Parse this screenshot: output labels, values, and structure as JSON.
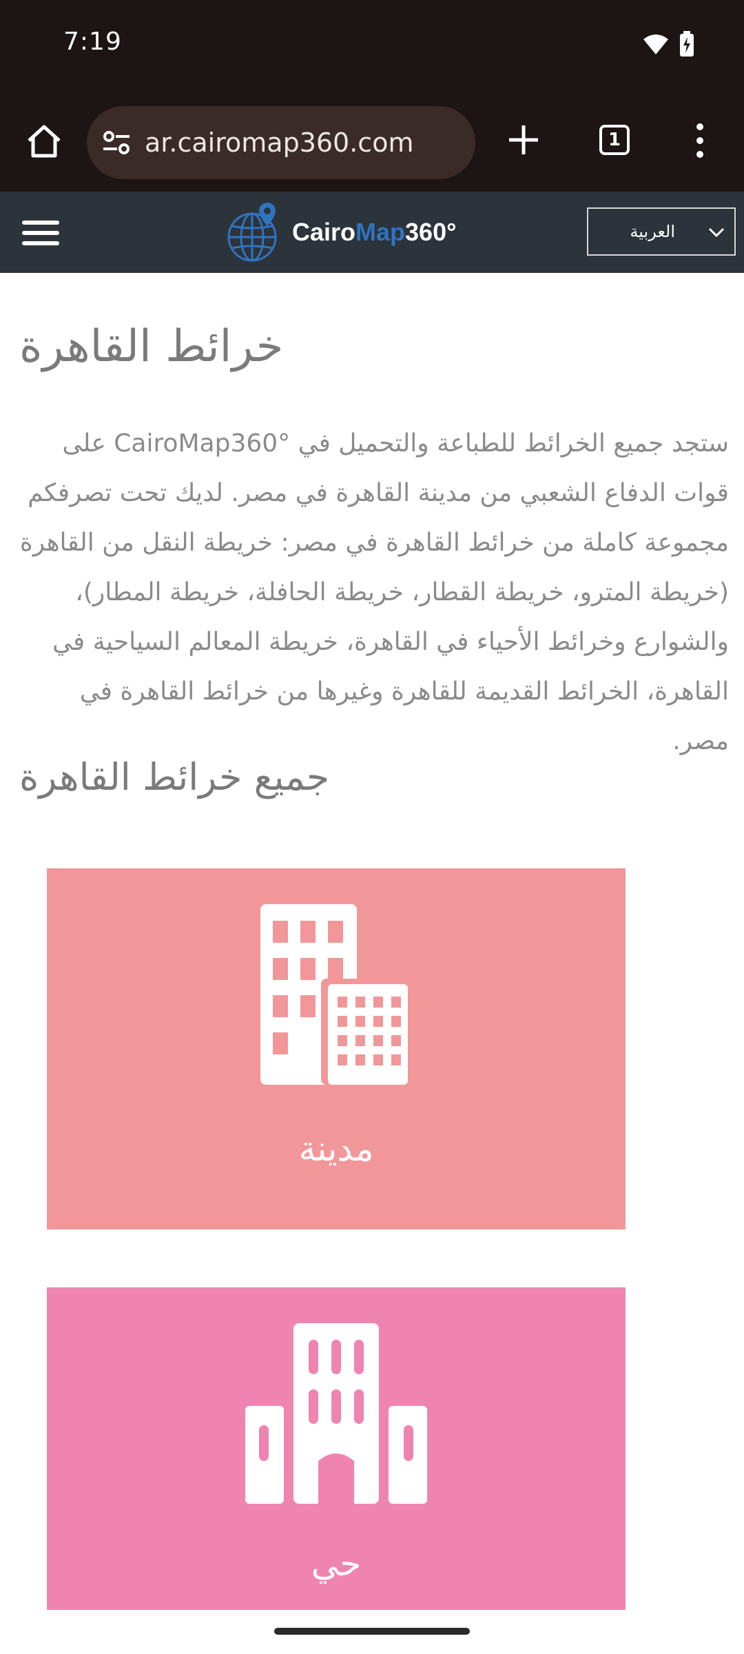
{
  "status_bar": {
    "time": "7:19",
    "icons": [
      "wifi-icon",
      "battery-charging-icon"
    ]
  },
  "browser": {
    "url": "ar.cairomap360.com",
    "tab_count": "1",
    "icons": [
      "home-icon",
      "site-settings-icon",
      "new-tab-icon",
      "tab-switcher-icon",
      "more-menu-icon"
    ]
  },
  "site_header": {
    "logo_part1": "Cairo",
    "logo_part2": "Map",
    "logo_part3": "360°",
    "language": "العربية",
    "colors": {
      "header_bg": "#2d333b",
      "logo_blue": "#2f74c0"
    }
  },
  "main": {
    "title": "خرائط القاهرة",
    "intro": "ستجد جميع الخرائط للطباعة والتحميل في CairoMap360° على قوات الدفاع الشعبي من مدينة القاهرة في مصر. لديك تحت تصرفكم مجموعة كاملة من خرائط القاهرة في مصر: خريطة النقل من القاهرة (خريطة المترو، خريطة القطار، خريطة الحافلة، خريطة المطار)، والشوارع وخرائط الأحياء في القاهرة، خريطة المعالم السياحية في القاهرة، الخرائط القديمة للقاهرة وغيرها من خرائط القاهرة في مصر.",
    "section_title": "جميع خرائط القاهرة",
    "cards": [
      {
        "label": "مدينة",
        "icon": "city-buildings-icon",
        "color": "#f19799"
      },
      {
        "label": "حي",
        "icon": "district-building-icon",
        "color": "#ef84b1"
      }
    ]
  }
}
